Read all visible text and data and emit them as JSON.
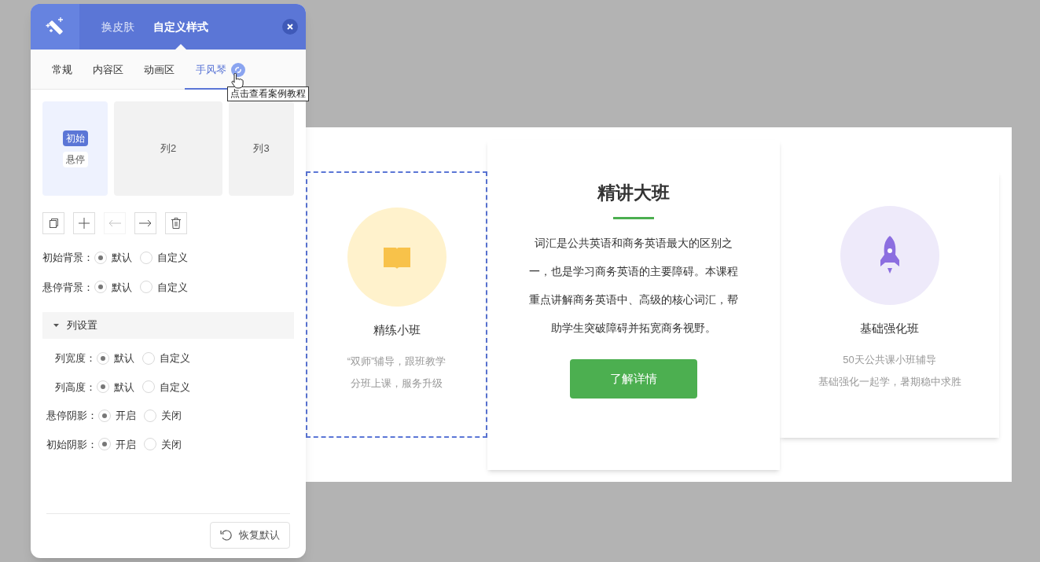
{
  "header": {
    "tabs": [
      {
        "label": "换皮肤",
        "selected": false
      },
      {
        "label": "自定义样式",
        "selected": true
      }
    ]
  },
  "subtabs": [
    {
      "label": "常规",
      "selected": false
    },
    {
      "label": "内容区",
      "selected": false
    },
    {
      "label": "动画区",
      "selected": false
    },
    {
      "label": "手风琴",
      "selected": true
    }
  ],
  "tooltip": "点击查看案例教程",
  "columns": [
    {
      "selected": true,
      "states": [
        {
          "label": "初始",
          "selected": true
        },
        {
          "label": "悬停",
          "selected": false
        }
      ]
    },
    {
      "label": "列2",
      "selected": false
    },
    {
      "label": "列3",
      "selected": false
    }
  ],
  "toolbar": [
    {
      "kind": "copy",
      "disabled": false
    },
    {
      "kind": "add",
      "disabled": false
    },
    {
      "kind": "left",
      "disabled": true
    },
    {
      "kind": "right",
      "disabled": false
    },
    {
      "kind": "delete",
      "disabled": false
    }
  ],
  "settings": [
    {
      "label": "初始背景：",
      "options": [
        {
          "label": "默认",
          "selected": true
        },
        {
          "label": "自定义",
          "selected": false
        }
      ]
    },
    {
      "label": "悬停背景：",
      "options": [
        {
          "label": "默认",
          "selected": true
        },
        {
          "label": "自定义",
          "selected": false
        }
      ]
    }
  ],
  "section": {
    "title": "列设置",
    "expanded": true,
    "settings": [
      {
        "label": "列宽度：",
        "options": [
          {
            "label": "默认",
            "selected": true
          },
          {
            "label": "自定义",
            "selected": false
          }
        ]
      },
      {
        "label": "列高度：",
        "options": [
          {
            "label": "默认",
            "selected": true
          },
          {
            "label": "自定义",
            "selected": false
          }
        ]
      },
      {
        "label": "悬停阴影：",
        "options": [
          {
            "label": "开启",
            "selected": true
          },
          {
            "label": "关闭",
            "selected": false
          }
        ]
      },
      {
        "label": "初始阴影：",
        "options": [
          {
            "label": "开启",
            "selected": true
          },
          {
            "label": "关闭",
            "selected": false
          }
        ]
      }
    ]
  },
  "reset_button": "恢复默认",
  "cards": [
    {
      "title": "精练小班",
      "selected": true,
      "expanded": false,
      "lines": [
        "“双师”辅导，跟班教学",
        "分班上课，服务升级"
      ]
    },
    {
      "title": "精讲大班",
      "selected": false,
      "expanded": true,
      "body": "词汇是公共英语和商务英语最大的区别之一，也是学习商务英语的主要障碍。本课程重点讲解商务英语中、高级的核心词汇，帮助学生突破障碍并拓宽商务视野。",
      "button": "了解详情"
    },
    {
      "title": "基础强化班",
      "selected": false,
      "expanded": false,
      "lines": [
        "50天公共课小班辅导",
        "基础强化一起学，暑期稳中求胜"
      ]
    }
  ]
}
